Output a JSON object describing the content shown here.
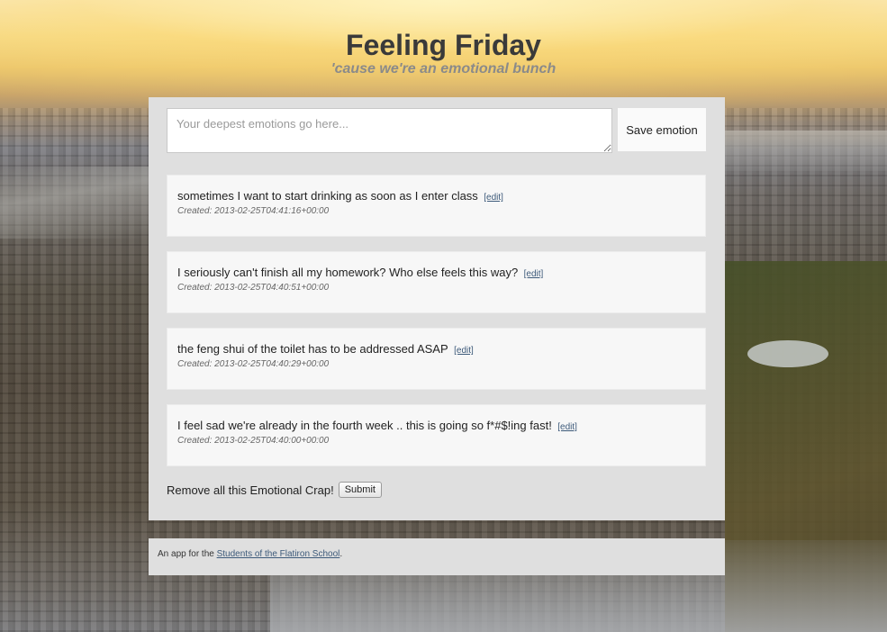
{
  "header": {
    "title": "Feeling Friday",
    "subtitle": "'cause we're an emotional bunch"
  },
  "form": {
    "placeholder": "Your deepest emotions go here...",
    "value": "",
    "save_label": "Save emotion"
  },
  "emotions": [
    {
      "text": "sometimes I want to start drinking as soon as I enter class",
      "edit_label": "[edit]",
      "created": "Created: 2013-02-25T04:41:16+00:00"
    },
    {
      "text": "I seriously can't finish all my homework? Who else feels this way?",
      "edit_label": "[edit]",
      "created": "Created: 2013-02-25T04:40:51+00:00"
    },
    {
      "text": "the feng shui of the toilet has to be addressed ASAP",
      "edit_label": "[edit]",
      "created": "Created: 2013-02-25T04:40:29+00:00"
    },
    {
      "text": "I feel sad we're already in the fourth week .. this is going so f*#$!ing fast!",
      "edit_label": "[edit]",
      "created": "Created: 2013-02-25T04:40:00+00:00"
    }
  ],
  "remove": {
    "label": "Remove all this Emotional Crap!",
    "submit_label": "Submit"
  },
  "footer": {
    "prefix": "An app for the ",
    "link_text": "Students of the Flatiron School",
    "suffix": "."
  },
  "colors": {
    "panel_bg": "#dfdfdf",
    "link": "#3d5a7a",
    "title": "#3a3a3a",
    "subtitle": "#8a8a8a"
  }
}
